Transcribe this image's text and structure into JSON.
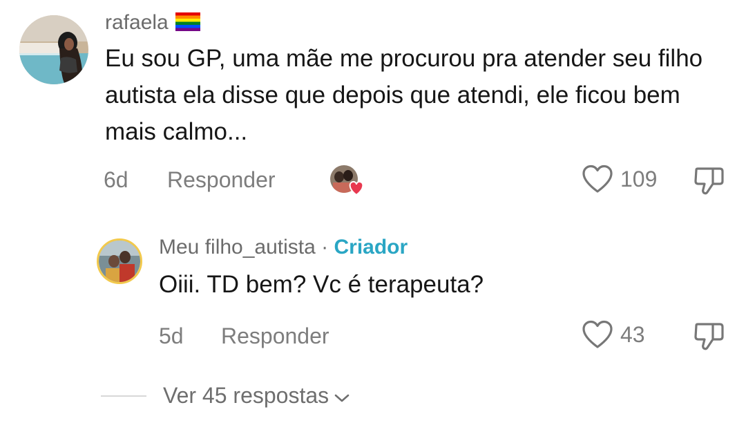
{
  "comment": {
    "username": "rafaela",
    "badge_icon": "rainbow-flag-icon",
    "text": "Eu sou GP, uma mãe me procurou pra atender seu filho autista ela disse que depois que atendi, ele ficou bem mais calmo...",
    "age": "6d",
    "reply_label": "Responder",
    "likes": "109",
    "creator_liked_icon": "creator-liked-heart-icon"
  },
  "reply": {
    "username": "Meu filho_autista",
    "separator": " · ",
    "creator_label": "Criador",
    "text": "Oiii. TD bem? Vc é terapeuta?",
    "age": "5d",
    "reply_label": "Responder",
    "likes": "43"
  },
  "view_replies": {
    "label": "Ver 45 respostas",
    "icon": "chevron-down-icon"
  },
  "colors": {
    "creator_accent": "#2aa6c4",
    "secondary_text": "#7d7d7d",
    "like_heart_red": "#e8384f"
  }
}
